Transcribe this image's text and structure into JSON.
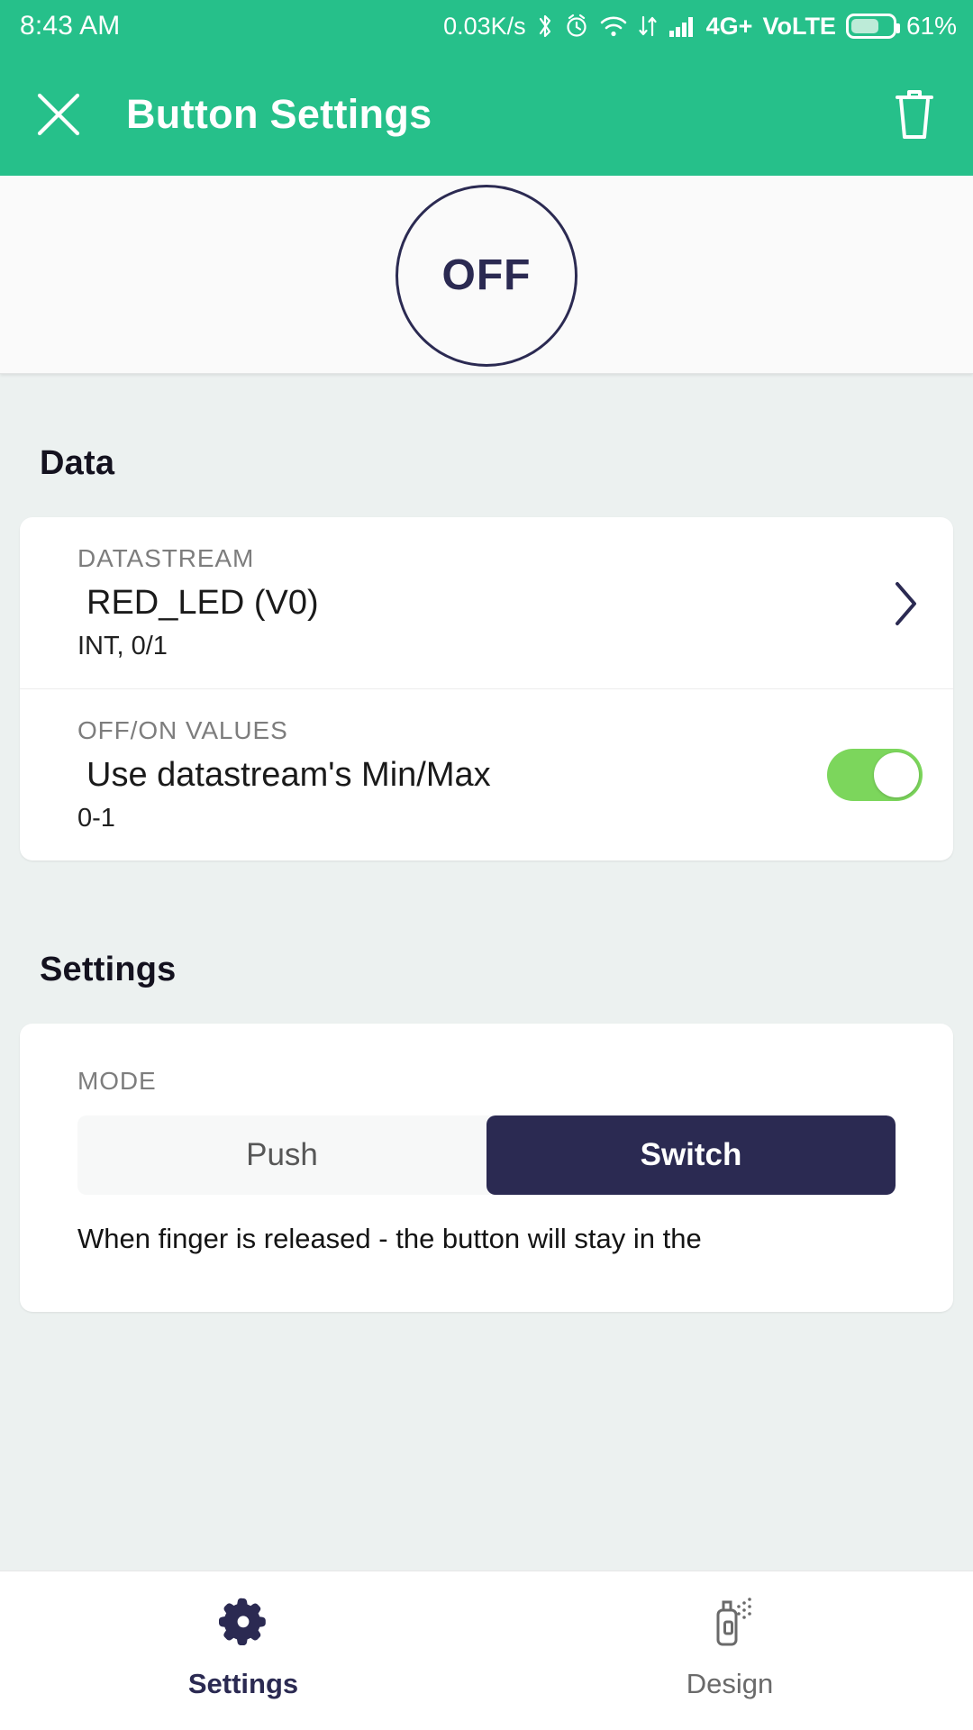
{
  "statusbar": {
    "time": "8:43 AM",
    "network_speed": "0.03K/s",
    "network_type": "4G+",
    "volte": "VoLTE",
    "battery_percent": "61%",
    "icons": [
      "bluetooth-icon",
      "alarm-icon",
      "wifi-icon",
      "data-transfer-icon",
      "signal-icon",
      "battery-icon"
    ]
  },
  "appbar": {
    "title": "Button Settings",
    "close_label": "close-icon",
    "delete_label": "delete-icon",
    "background_color": "#26C08A"
  },
  "preview": {
    "widget_state_label": "OFF",
    "outline_color": "#2B2A52"
  },
  "data_section": {
    "heading": "Data",
    "rows": [
      {
        "label": "DATASTREAM",
        "value": "RED_LED (V0)",
        "sub": "INT, 0/1",
        "accessory": "chevron-right-icon"
      },
      {
        "label": "OFF/ON VALUES",
        "value": "Use datastream's Min/Max",
        "sub": "0-1",
        "accessory": "toggle-on",
        "toggle_color": "#7CD65C"
      }
    ]
  },
  "settings_section": {
    "heading": "Settings",
    "mode_label": "MODE",
    "mode_options": [
      {
        "label": "Push",
        "selected": false
      },
      {
        "label": "Switch",
        "selected": true
      }
    ],
    "mode_description": "When finger is released - the button will stay in the"
  },
  "bottomnav": {
    "items": [
      {
        "label": "Settings",
        "icon": "gear-icon",
        "active": true
      },
      {
        "label": "Design",
        "icon": "spray-can-icon",
        "active": false
      }
    ]
  }
}
